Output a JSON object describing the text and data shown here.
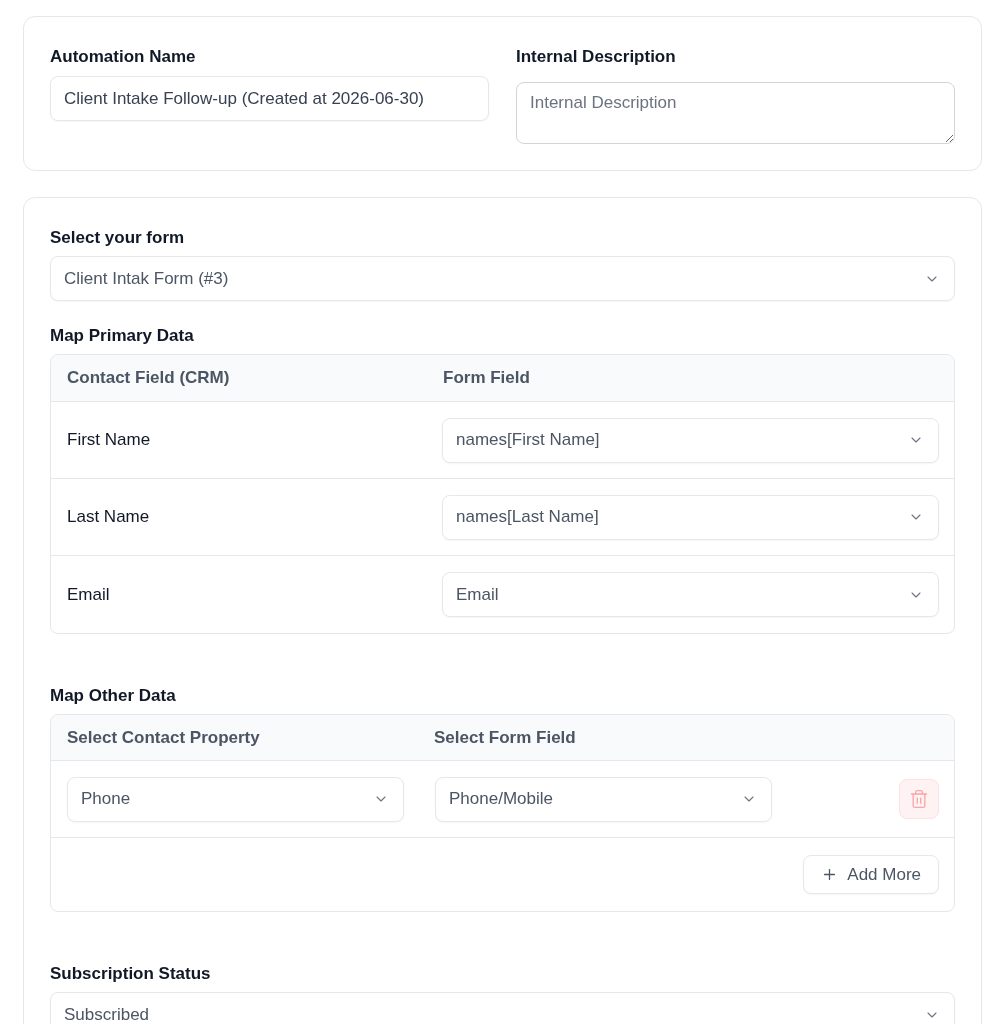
{
  "general": {
    "automation_name": {
      "label": "Automation Name",
      "value": "Client Intake Follow-up (Created at 2026-06-30)"
    },
    "internal_description": {
      "label": "Internal Description",
      "placeholder": "Internal Description"
    }
  },
  "form_select": {
    "label": "Select your form",
    "value": "Client Intak Form (#3)"
  },
  "primary_data": {
    "title": "Map Primary Data",
    "columns": [
      "Contact Field (CRM)",
      "Form Field"
    ],
    "rows": [
      {
        "contact_field": "First Name",
        "form_field": "names[First Name]"
      },
      {
        "contact_field": "Last Name",
        "form_field": "names[Last Name]"
      },
      {
        "contact_field": "Email",
        "form_field": "Email"
      }
    ]
  },
  "other_data": {
    "title": "Map Other Data",
    "columns": [
      "Select Contact Property",
      "Select Form Field"
    ],
    "rows": [
      {
        "contact_property": "Phone",
        "form_field": "Phone/Mobile"
      }
    ],
    "add_button": "Add More"
  },
  "subscription": {
    "label": "Subscription Status",
    "value": "Subscribed"
  }
}
